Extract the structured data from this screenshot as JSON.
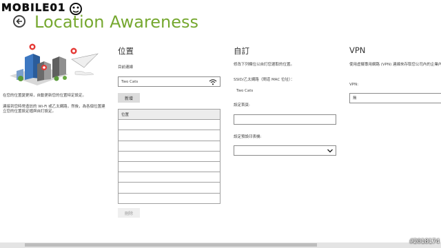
{
  "watermark": {
    "text": "MOBILE01"
  },
  "app": {
    "title": "Location Awareness"
  },
  "intro": {
    "line1": "在您的位置變更時，自動更新您的位置特定設定。",
    "line2": "連接到您時常造訪的 Wi-Fi 或乙太網路，然後，為各個位置建",
    "line3": "立您的位置設定檔與自訂設定。"
  },
  "locations": {
    "heading": "位置",
    "current_label": "目前連線",
    "current_value": "Two Cats",
    "add_label": "新增",
    "table_header": "位置",
    "rows": [
      "",
      "",
      "",
      "",
      "",
      "",
      "",
      ""
    ],
    "delete_label": "刪除"
  },
  "custom": {
    "heading": "自訂",
    "desc": "修改下列欄位以自訂您選取的位置。",
    "ssid_label": "SSID/乙太網路（閘道 MAC 位址）：",
    "ssid_value": "Two Cats",
    "homepage_label": "設定首頁:",
    "homepage_value": "",
    "printer_label": "設定預設印表機:",
    "printer_value": ""
  },
  "vpn": {
    "heading": "VPN",
    "desc": "使用虛擬專用網路 (VPN) 連線來存取您公司內的企業內部",
    "field_label": "VPN:",
    "field_value": "無"
  },
  "stamp": "#2018174"
}
